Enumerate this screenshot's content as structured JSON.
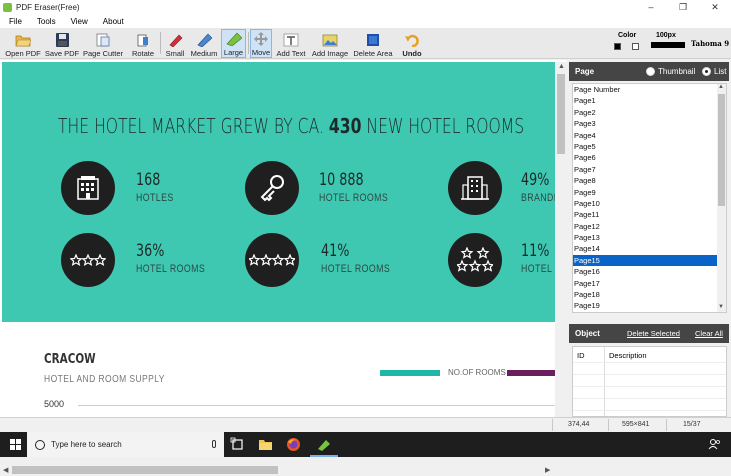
{
  "window": {
    "title": "PDF Eraser(Free)",
    "controls": [
      "–",
      "❐",
      "✕"
    ]
  },
  "menu": [
    "File",
    "Tools",
    "View",
    "About"
  ],
  "toolbar": {
    "buttons": [
      {
        "label": "Open PDF",
        "icon": "folder-open-icon"
      },
      {
        "label": "Save PDF",
        "icon": "floppy-disk-icon"
      },
      {
        "label": "Page Cutter",
        "icon": "page-cutter-icon"
      },
      {
        "label": "Rotate",
        "icon": "rotate-icon"
      },
      {
        "label": "Small",
        "icon": "eraser-small-icon"
      },
      {
        "label": "Medium",
        "icon": "eraser-medium-icon"
      },
      {
        "label": "Large",
        "icon": "eraser-large-icon"
      },
      {
        "label": "Move",
        "icon": "move-icon"
      },
      {
        "label": "Add Text",
        "icon": "add-text-icon"
      },
      {
        "label": "Add Image",
        "icon": "add-image-icon"
      },
      {
        "label": "Delete Area",
        "icon": "delete-area-icon"
      },
      {
        "label": "Undo",
        "icon": "undo-icon"
      }
    ],
    "color_label": "Color",
    "size_label": "100px",
    "font_label": "Tahoma 9",
    "colors": {
      "fg": "#000000",
      "bg": "#ffffff"
    }
  },
  "document": {
    "headline_pre": "THE HOTEL MARKET GREW BY CA.",
    "headline_num": "430",
    "headline_post": "NEW HOTEL ROOMS",
    "stats": [
      {
        "num": "168",
        "label": "HOTLES",
        "icon": "hotel-building-icon"
      },
      {
        "num": "10 888",
        "label": "HOTEL ROOMS",
        "icon": "key-icon"
      },
      {
        "num": "49%",
        "label": "BRANDE",
        "icon": "city-building-icon"
      },
      {
        "num": "36%",
        "label": "HOTEL ROOMS",
        "icon": "three-stars-icon"
      },
      {
        "num": "41%",
        "label": "HOTEL ROOMS",
        "icon": "four-stars-icon"
      },
      {
        "num": "11%",
        "label": "HOTEL R",
        "icon": "five-stars-icon"
      }
    ],
    "section_title": "CRACOW",
    "section_subtitle": "HOTEL AND ROOM SUPPLY",
    "legend_label": "NO.OF ROOMS",
    "axis_tick": "5000",
    "colors": {
      "teal": "#3ec8b1",
      "legend1": "#1fb8a8",
      "legend2": "#6b1e5e"
    }
  },
  "page_panel": {
    "title": "Page",
    "thumbnail_label": "Thumbnail",
    "list_label": "List",
    "header": "Page Number",
    "pages": [
      "Page1",
      "Page2",
      "Page3",
      "Page4",
      "Page5",
      "Page6",
      "Page7",
      "Page8",
      "Page9",
      "Page10",
      "Page11",
      "Page12",
      "Page13",
      "Page14",
      "Page15",
      "Page16",
      "Page17",
      "Page18",
      "Page19"
    ],
    "selected": "Page15"
  },
  "object_panel": {
    "title": "Object",
    "delete_selected": "Delete Selected",
    "clear_all": "Clear All",
    "col_id": "ID",
    "col_desc": "Description"
  },
  "status": {
    "coords": "374,44",
    "page_size": "595×841",
    "page_index": "15/37"
  },
  "taskbar": {
    "search_placeholder": "Type here to search"
  }
}
